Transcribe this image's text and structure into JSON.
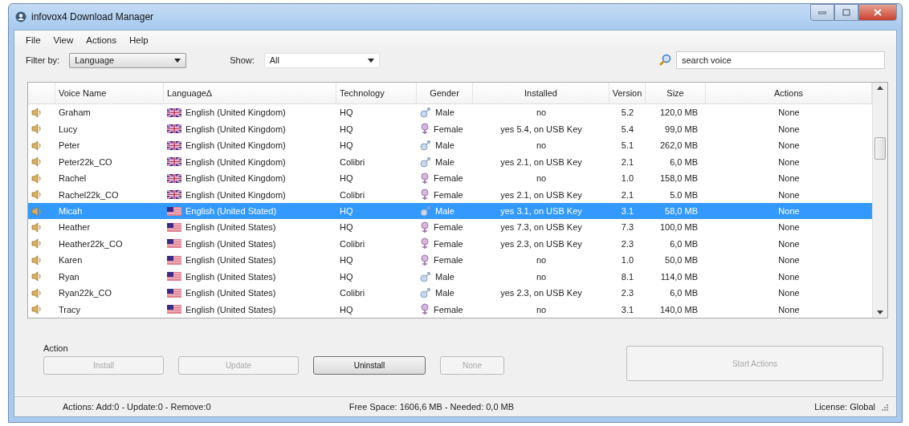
{
  "window": {
    "title": "infovox4 Download Manager"
  },
  "menu": [
    "File",
    "View",
    "Actions",
    "Help"
  ],
  "filter": {
    "label": "Filter by:",
    "value": "Language"
  },
  "show": {
    "label": "Show:",
    "value": "All"
  },
  "search": {
    "placeholder": "search voice"
  },
  "table": {
    "columns": [
      "Voice Name",
      "Language∆",
      "Technology",
      "Gender",
      "Installed",
      "Version",
      "Size",
      "Actions"
    ],
    "rows": [
      {
        "name": "Graham",
        "language": {
          "kind": "uk",
          "text": "English (United Kingdom)"
        },
        "technology": "HQ",
        "gender": {
          "kind": "male",
          "text": "Male"
        },
        "installed": "no",
        "version": "5.2",
        "size": "120,0 MB",
        "actions": "None",
        "selected": false
      },
      {
        "name": "Lucy",
        "language": {
          "kind": "uk",
          "text": "English (United Kingdom)"
        },
        "technology": "HQ",
        "gender": {
          "kind": "female",
          "text": "Female"
        },
        "installed": "yes 5.4, on USB Key",
        "version": "5.4",
        "size": "99,0 MB",
        "actions": "None",
        "selected": false
      },
      {
        "name": "Peter",
        "language": {
          "kind": "uk",
          "text": "English (United Kingdom)"
        },
        "technology": "HQ",
        "gender": {
          "kind": "male",
          "text": "Male"
        },
        "installed": "no",
        "version": "5.1",
        "size": "262,0 MB",
        "actions": "None",
        "selected": false
      },
      {
        "name": "Peter22k_CO",
        "language": {
          "kind": "uk",
          "text": "English (United Kingdom)"
        },
        "technology": "Colibri",
        "gender": {
          "kind": "male",
          "text": "Male"
        },
        "installed": "yes 2.1, on USB Key",
        "version": "2.1",
        "size": "6,0 MB",
        "actions": "None",
        "selected": false
      },
      {
        "name": "Rachel",
        "language": {
          "kind": "uk",
          "text": "English (United Kingdom)"
        },
        "technology": "HQ",
        "gender": {
          "kind": "female",
          "text": "Female"
        },
        "installed": "no",
        "version": "1.0",
        "size": "158,0 MB",
        "actions": "None",
        "selected": false
      },
      {
        "name": "Rachel22k_CO",
        "language": {
          "kind": "uk",
          "text": "English (United Kingdom)"
        },
        "technology": "Colibri",
        "gender": {
          "kind": "female",
          "text": "Female"
        },
        "installed": "yes 2.1, on USB Key",
        "version": "2.1",
        "size": "5.0 MB",
        "actions": "None",
        "selected": false
      },
      {
        "name": "Micah",
        "language": {
          "kind": "us",
          "text": "English (United Stated)"
        },
        "technology": "HQ",
        "gender": {
          "kind": "male",
          "text": "Male"
        },
        "installed": "yes 3.1, on USB Key",
        "version": "3.1",
        "size": "58,0 MB",
        "actions": "None",
        "selected": true
      },
      {
        "name": "Heather",
        "language": {
          "kind": "us",
          "text": "English (United States)"
        },
        "technology": "HQ",
        "gender": {
          "kind": "female",
          "text": "Female"
        },
        "installed": "yes 7.3, on USB Key",
        "version": "7.3",
        "size": "100,0 MB",
        "actions": "None",
        "selected": false
      },
      {
        "name": "Heather22k_CO",
        "language": {
          "kind": "us",
          "text": "English (United States)"
        },
        "technology": "Colibri",
        "gender": {
          "kind": "female",
          "text": "Female"
        },
        "installed": "yes 2.3, on USB Key",
        "version": "2.3",
        "size": "6,0 MB",
        "actions": "None",
        "selected": false
      },
      {
        "name": "Karen",
        "language": {
          "kind": "us",
          "text": "English (United States)"
        },
        "technology": "HQ",
        "gender": {
          "kind": "female",
          "text": "Female"
        },
        "installed": "no",
        "version": "1.0",
        "size": "50,0 MB",
        "actions": "None",
        "selected": false
      },
      {
        "name": "Ryan",
        "language": {
          "kind": "us",
          "text": "English (United States)"
        },
        "technology": "HQ",
        "gender": {
          "kind": "male",
          "text": "Male"
        },
        "installed": "no",
        "version": "8.1",
        "size": "114,0 MB",
        "actions": "None",
        "selected": false
      },
      {
        "name": "Ryan22k_CO",
        "language": {
          "kind": "us",
          "text": "English (United States)"
        },
        "technology": "Colibri",
        "gender": {
          "kind": "male",
          "text": "Male"
        },
        "installed": "yes 2.3, on USB Key",
        "version": "2.3",
        "size": "6,0 MB",
        "actions": "None",
        "selected": false
      },
      {
        "name": "Tracy",
        "language": {
          "kind": "us",
          "text": "English (United States)"
        },
        "technology": "HQ",
        "gender": {
          "kind": "female",
          "text": "Female"
        },
        "installed": "no",
        "version": "3.1",
        "size": "140,0 MB",
        "actions": "None",
        "selected": false
      }
    ]
  },
  "action_group": {
    "title": "Action",
    "buttons": [
      {
        "label": "Install",
        "disabled": true
      },
      {
        "label": "Update",
        "disabled": true
      },
      {
        "label": "Uninstall",
        "disabled": false
      },
      {
        "label": "None",
        "disabled": true
      }
    ],
    "start": {
      "label": "Start Actions",
      "disabled": true
    }
  },
  "status_bar": [
    "Actions: Add:0 - Update:0 - Remove:0",
    "Free Space: 1606,6 MB - Needed: 0,0 MB",
    "License: Global"
  ]
}
